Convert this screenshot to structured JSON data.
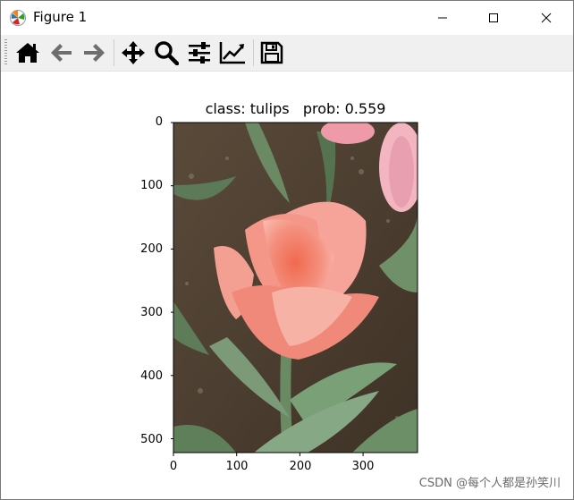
{
  "window": {
    "title": "Figure 1",
    "controls": [
      "minimize",
      "maximize",
      "close"
    ]
  },
  "toolbar": {
    "buttons": [
      {
        "name": "home",
        "icon": "home-icon"
      },
      {
        "name": "back",
        "icon": "arrow-left-icon"
      },
      {
        "name": "forward",
        "icon": "arrow-right-icon"
      },
      {
        "name": "pan",
        "icon": "move-icon"
      },
      {
        "name": "zoom",
        "icon": "magnifier-icon"
      },
      {
        "name": "configure-subplots",
        "icon": "sliders-icon"
      },
      {
        "name": "edit-axis",
        "icon": "line-chart-icon"
      },
      {
        "name": "save",
        "icon": "floppy-disk-icon"
      }
    ]
  },
  "plot": {
    "title": "class: tulips   prob: 0.559",
    "image_subject": "pink tulip flower",
    "y_ticks": [
      "0",
      "100",
      "200",
      "300",
      "400",
      "500"
    ],
    "x_ticks": [
      "0",
      "100",
      "200",
      "300"
    ],
    "colors": {
      "petal": "#f28b7e",
      "leaf": "#6f8f6a",
      "soil": "#4a3a2e"
    }
  },
  "watermark": "CSDN @每个人都是孙笑川"
}
